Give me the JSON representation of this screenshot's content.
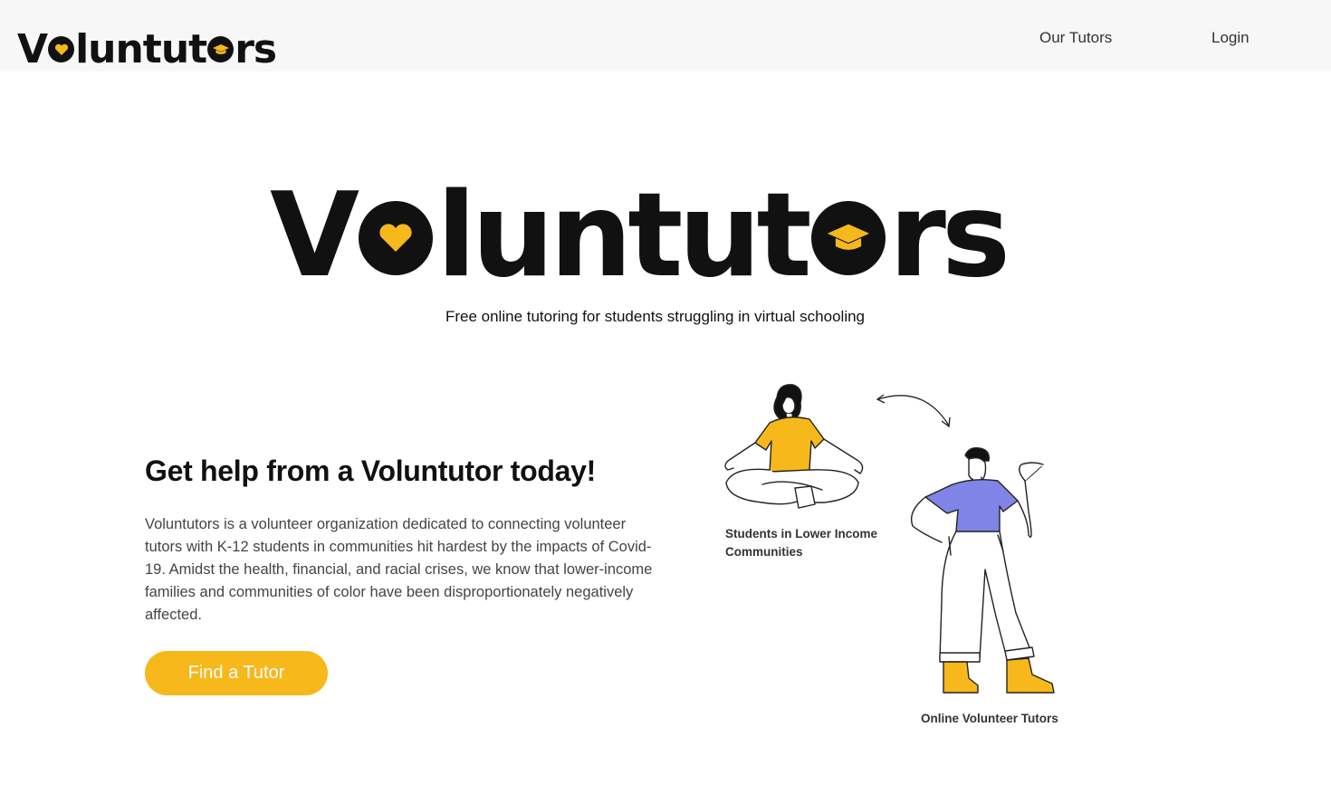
{
  "brand": {
    "name_part1": "V",
    "name_part2": "lunt",
    "name_part3": "ut",
    "name_part4": "rs",
    "accent_color": "#f6b81b",
    "heart_icon": "heart-icon",
    "cap_icon": "graduation-cap-icon"
  },
  "nav": {
    "links": [
      {
        "label": "Our Tutors"
      },
      {
        "label": "Login"
      }
    ]
  },
  "hero": {
    "tagline": "Free online tutoring for students struggling in virtual schooling"
  },
  "cta": {
    "heading": "Get help from a Voluntutor today!",
    "body": "Voluntutors is a volunteer organization dedicated to connecting volunteer tutors with K-12 students in communities hit hardest by the impacts of Covid-19. Amidst the health, financial, and racial crises, we know that lower-income families and communities of color have been disproportionately negatively affected.",
    "button_label": "Find a Tutor"
  },
  "illustration": {
    "caption_students": "Students in Lower Income Communities",
    "caption_tutors": "Online Volunteer Tutors",
    "student_shirt_color": "#f6b81b",
    "tutor_shirt_color": "#7f84e6"
  }
}
